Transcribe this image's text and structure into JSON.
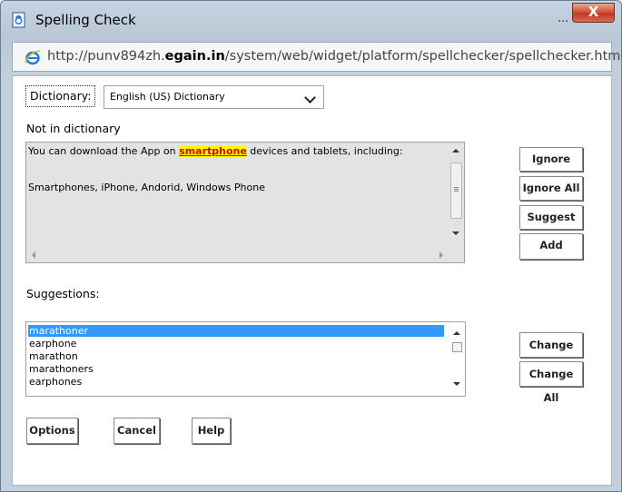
{
  "window": {
    "title": "Spelling Check",
    "minimize_glyph": "...",
    "close_glyph": "X"
  },
  "address": {
    "url_prefix": "http://punv894zh.",
    "url_domain": "egain.in",
    "url_suffix": "/system/web/widget/platform/spellchecker/spellchecker.html"
  },
  "dictionary": {
    "label": "Dictionary:",
    "selected": "English (US) Dictionary"
  },
  "not_in_dictionary": {
    "label": "Not in dictionary",
    "line1_before": "You can download the App on ",
    "misspelled_word": "smartphone",
    "line1_after": " devices and tablets, including:",
    "line2": "Smartphones, iPhone, Andorid, Windows Phone"
  },
  "actions": {
    "ignore": "Ignore",
    "ignore_all": "Ignore All",
    "suggest": "Suggest",
    "add": "Add"
  },
  "suggestions": {
    "label": "Suggestions:",
    "items": [
      "marathoner",
      "earphone",
      "marathon",
      "marathoners",
      "earphones"
    ],
    "selected_index": 0
  },
  "change": {
    "change": "Change",
    "change_all": "Change All"
  },
  "footer": {
    "options": "Options",
    "cancel": "Cancel",
    "help": "Help"
  },
  "colors": {
    "selection": "#3399ff",
    "misspelled_text": "#e00000",
    "misspelled_highlight": "#ffff00",
    "close_button": "#c03a24"
  }
}
